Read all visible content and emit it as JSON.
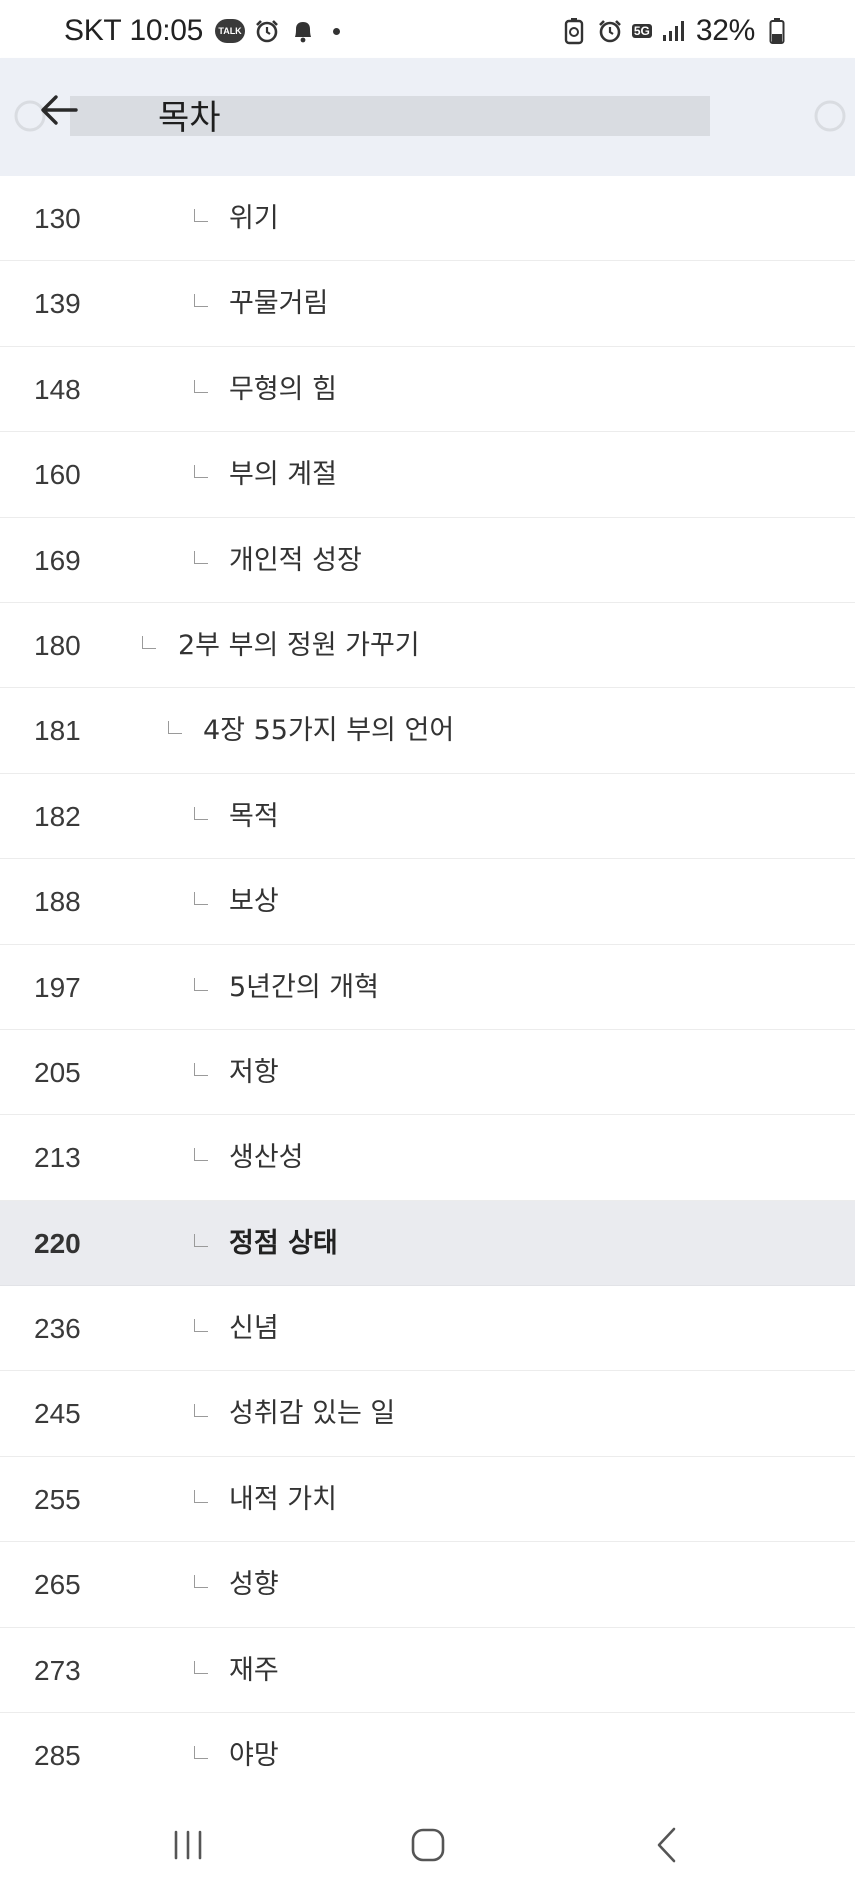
{
  "status_bar": {
    "carrier": "SKT",
    "time": "10:05",
    "talk_badge": "TALK",
    "network": "5G",
    "battery": "32%"
  },
  "header": {
    "title": "목차",
    "back_icon": "arrow-left-icon"
  },
  "toc": [
    {
      "page": "130",
      "title": "위기",
      "level": 3,
      "active": false
    },
    {
      "page": "139",
      "title": "꾸물거림",
      "level": 3,
      "active": false
    },
    {
      "page": "148",
      "title": "무형의 힘",
      "level": 3,
      "active": false
    },
    {
      "page": "160",
      "title": "부의 계절",
      "level": 3,
      "active": false
    },
    {
      "page": "169",
      "title": "개인적 성장",
      "level": 3,
      "active": false
    },
    {
      "page": "180",
      "title": "2부 부의 정원 가꾸기",
      "level": 1,
      "active": false
    },
    {
      "page": "181",
      "title": "4장 55가지 부의 언어",
      "level": 2,
      "active": false
    },
    {
      "page": "182",
      "title": "목적",
      "level": 3,
      "active": false
    },
    {
      "page": "188",
      "title": "보상",
      "level": 3,
      "active": false
    },
    {
      "page": "197",
      "title": "5년간의 개혁",
      "level": 3,
      "active": false
    },
    {
      "page": "205",
      "title": "저항",
      "level": 3,
      "active": false
    },
    {
      "page": "213",
      "title": "생산성",
      "level": 3,
      "active": false
    },
    {
      "page": "220",
      "title": "정점 상태",
      "level": 3,
      "active": true
    },
    {
      "page": "236",
      "title": "신념",
      "level": 3,
      "active": false
    },
    {
      "page": "245",
      "title": "성취감 있는 일",
      "level": 3,
      "active": false
    },
    {
      "page": "255",
      "title": "내적 가치",
      "level": 3,
      "active": false
    },
    {
      "page": "265",
      "title": "성향",
      "level": 3,
      "active": false
    },
    {
      "page": "273",
      "title": "재주",
      "level": 3,
      "active": false
    },
    {
      "page": "285",
      "title": "야망",
      "level": 3,
      "active": false
    }
  ],
  "nav_bar": {
    "recents_icon": "recent-apps-icon",
    "home_icon": "home-icon",
    "back_icon": "back-chevron-icon"
  },
  "colors": {
    "header_bg": "#edf0f6",
    "active_row_bg": "#eaebef",
    "divider": "#ececec",
    "text": "#333333"
  }
}
